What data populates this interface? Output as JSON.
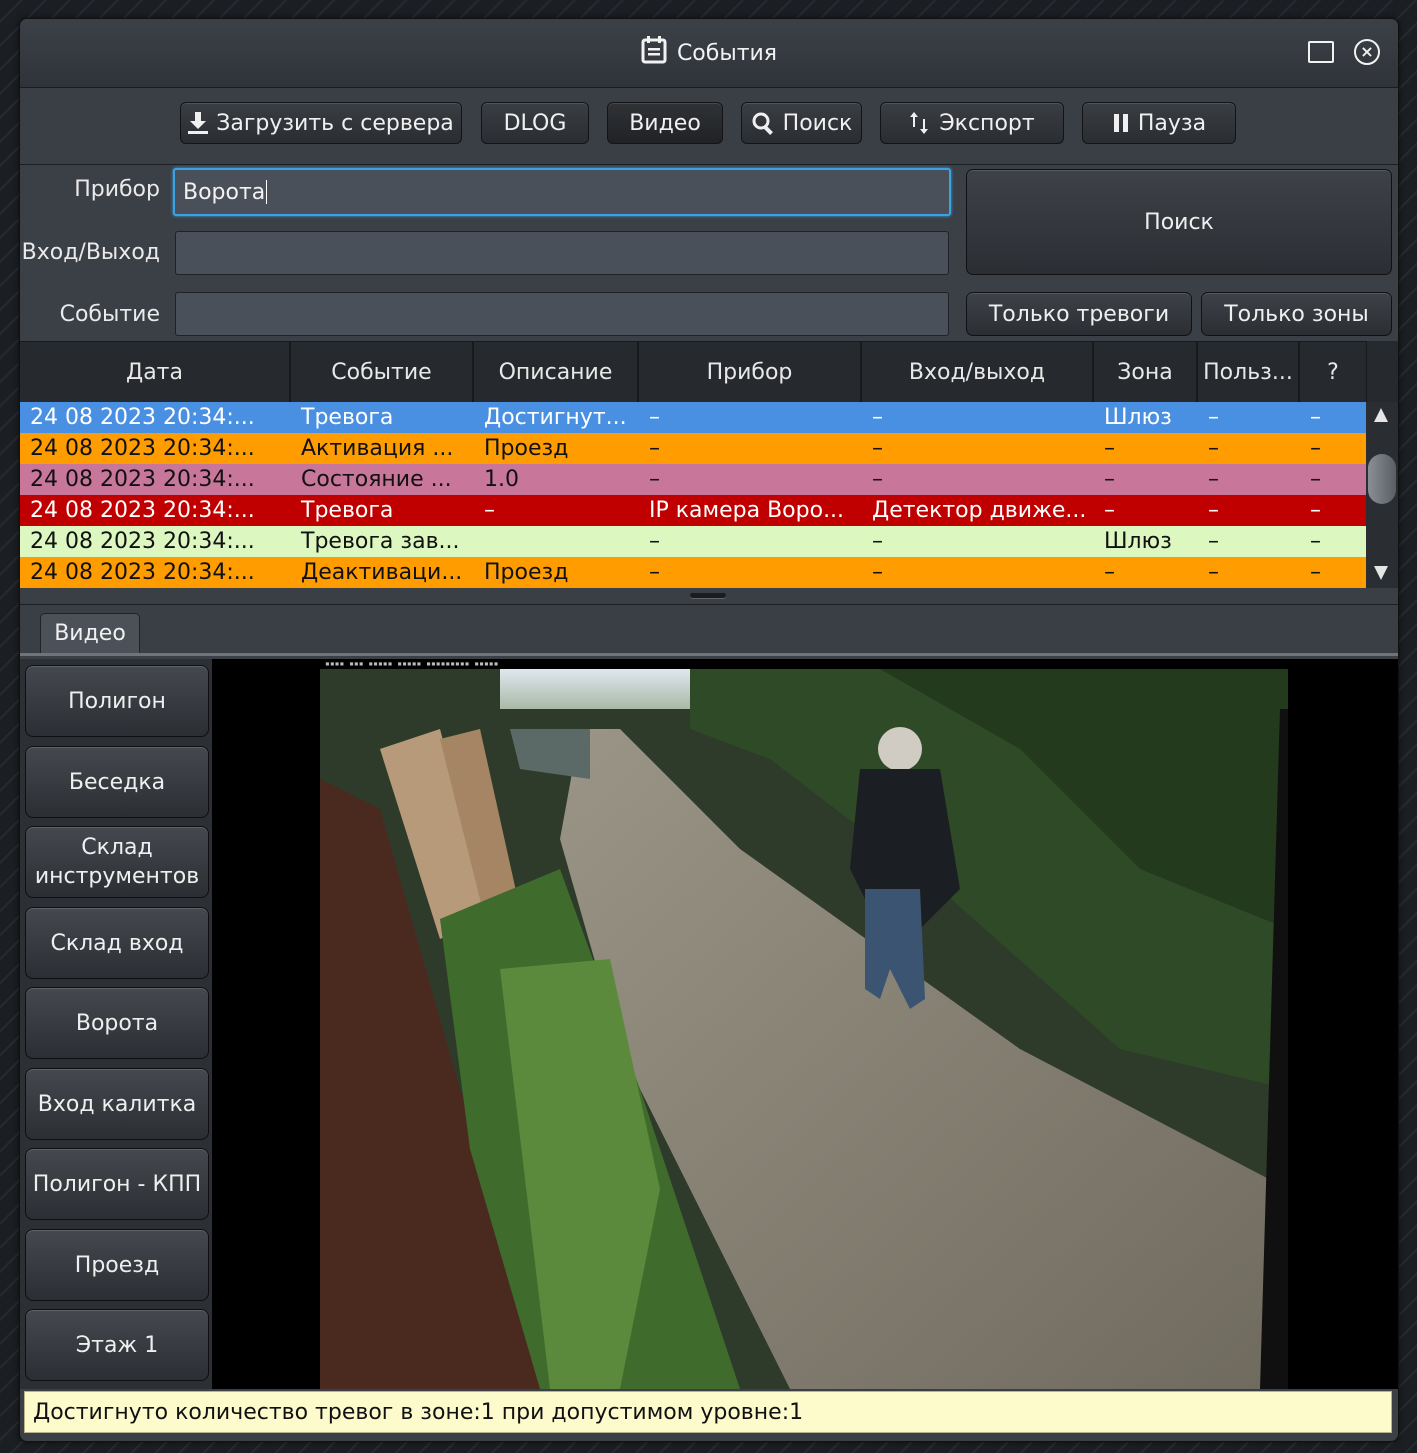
{
  "window": {
    "title": "События",
    "title_icon": "calendar-note-icon",
    "controls": [
      "maximize-icon",
      "close-icon"
    ]
  },
  "toolbar": {
    "download_label": "Загрузить с сервера",
    "dlog_label": "DLOG",
    "video_label": "Видео",
    "search_label": "Поиск",
    "export_label": "Экспорт",
    "pause_label": "Пауза"
  },
  "filters": {
    "device_label": "Прибор",
    "device_value": "Ворота",
    "io_label": "Вход/Выход",
    "io_value": "",
    "event_label": "Событие",
    "event_value": "",
    "search_button": "Поиск",
    "only_alarms": "Только тревоги",
    "only_zones": "Только зоны"
  },
  "table": {
    "columns": [
      "Дата",
      "Событие",
      "Описание",
      "Прибор",
      "Вход/выход",
      "Зона",
      "Польз...",
      "?"
    ],
    "rows": [
      {
        "cells": [
          "24 08 2023 20:34:...",
          "Тревога",
          "Достигнут...",
          "–",
          "–",
          "Шлюз",
          "–",
          "–"
        ],
        "bg": "#4a90e2",
        "fg": "#ffffff"
      },
      {
        "cells": [
          "24 08 2023 20:34:...",
          "Активация ...",
          "Проезд",
          "–",
          "–",
          "–",
          "–",
          "–"
        ],
        "bg": "#ff9d00",
        "fg": "#111111"
      },
      {
        "cells": [
          "24 08 2023 20:34:...",
          "Состояние ...",
          "1.0",
          "–",
          "–",
          "–",
          "–",
          "–"
        ],
        "bg": "#c8779a",
        "fg": "#111111"
      },
      {
        "cells": [
          "24 08 2023 20:34:...",
          "Тревога",
          "–",
          "IP камера Воро...",
          "Детектор движе...",
          "–",
          "–",
          "–"
        ],
        "bg": "#c00000",
        "fg": "#ffffff"
      },
      {
        "cells": [
          "24 08 2023 20:34:...",
          "Тревога зав...",
          "",
          "–",
          "–",
          "Шлюз",
          "–",
          "–"
        ],
        "bg": "#dcf7c0",
        "fg": "#111111"
      },
      {
        "cells": [
          "24 08 2023 20:34:...",
          "Деактиваци...",
          "Проезд",
          "–",
          "–",
          "–",
          "–",
          "–"
        ],
        "bg": "#ff9d00",
        "fg": "#111111"
      }
    ]
  },
  "tabs": {
    "video_tab": "Видео"
  },
  "sidebar": {
    "items": [
      "Полигон",
      "Беседка",
      "Склад инструментов",
      "Склад вход",
      "Ворота",
      "Вход калитка",
      "Полигон - КПП",
      "Проезд",
      "Этаж 1"
    ]
  },
  "status": {
    "message": "Достигнуто количество тревог в зоне:1 при допустимом уровне:1"
  }
}
